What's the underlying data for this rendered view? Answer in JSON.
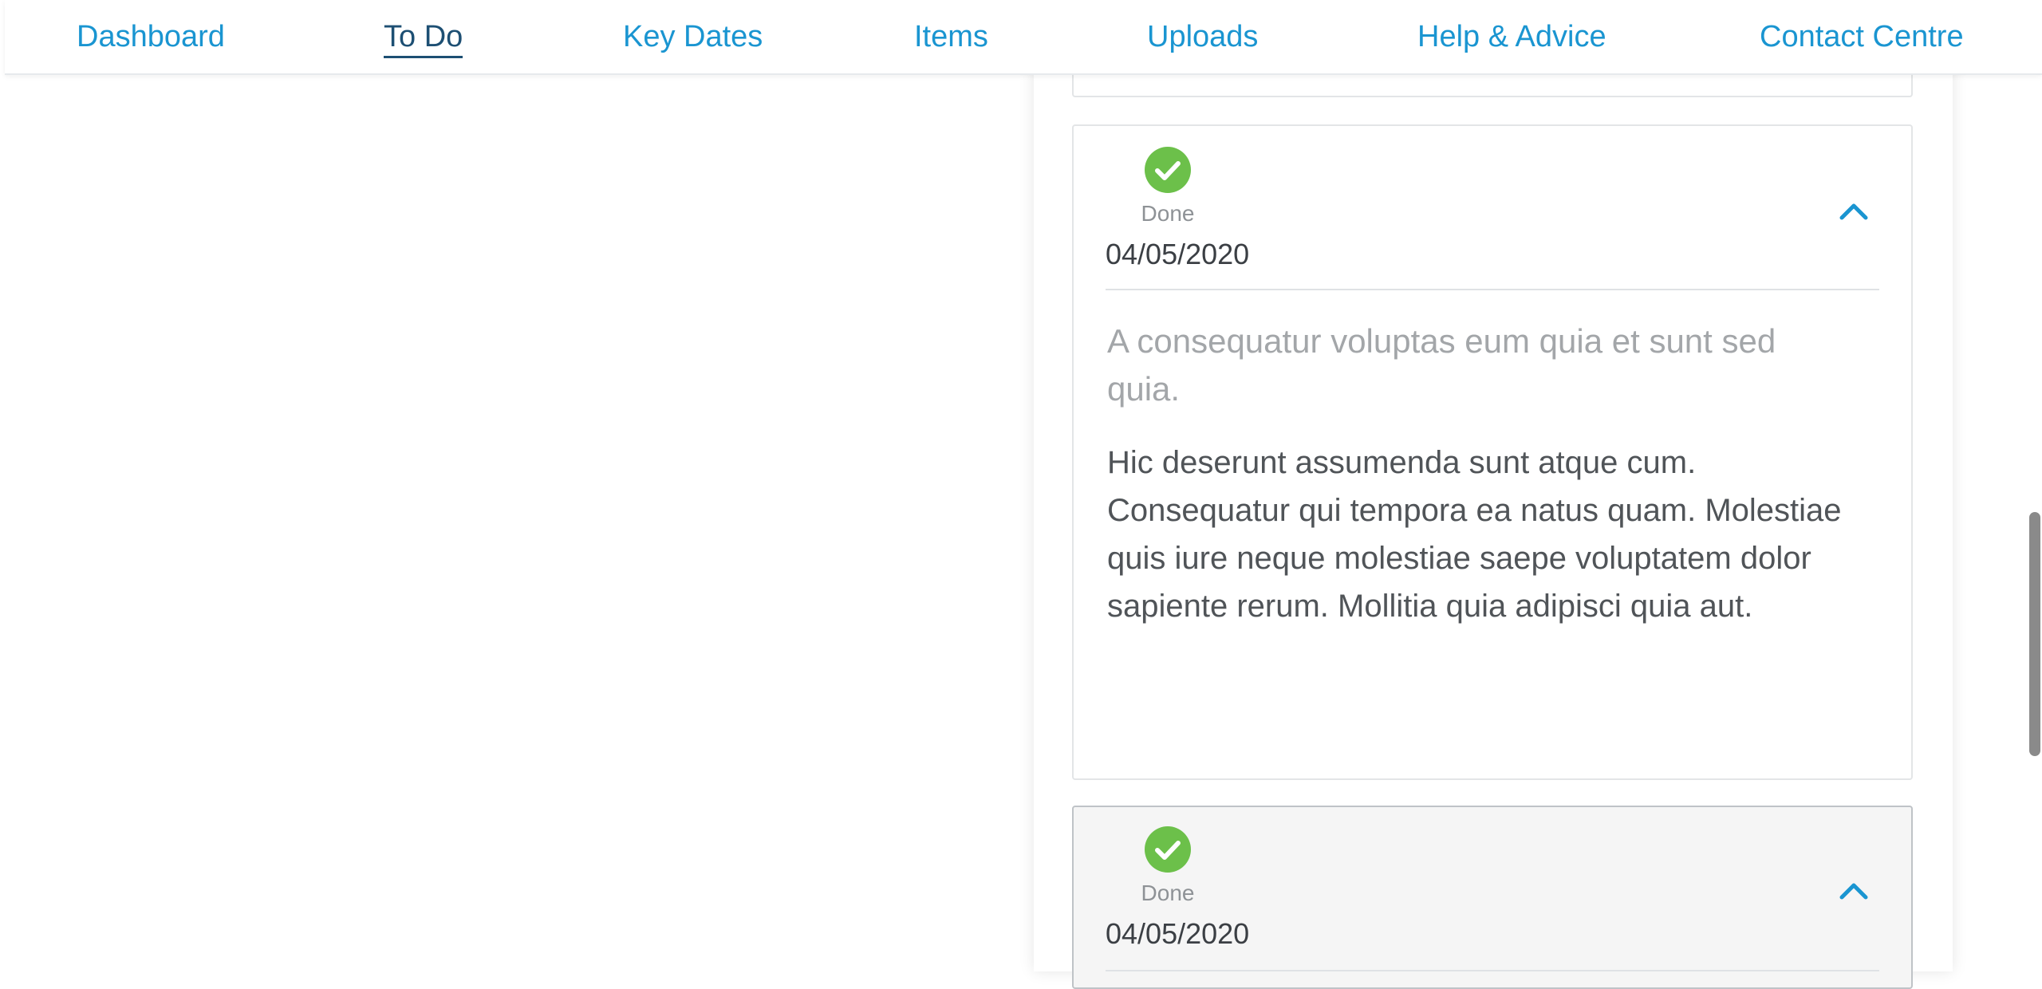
{
  "nav": {
    "items": [
      {
        "label": "Dashboard"
      },
      {
        "label": "To Do"
      },
      {
        "label": "Key Dates"
      },
      {
        "label": "Items"
      },
      {
        "label": "Uploads"
      },
      {
        "label": "Help & Advice"
      },
      {
        "label": "Contact Centre"
      }
    ],
    "active": "To Do"
  },
  "cards": [
    {
      "status": "Done",
      "date": "04/05/2020",
      "subtitle": "A consequatur voluptas eum quia et sunt sed quia.",
      "body": "Hic deserunt assumenda sunt atque cum. Consequatur qui tempora ea natus quam. Molestiae quis iure neque molestiae saepe voluptatem dolor sapiente rerum. Mollitia quia adipisci quia aut.",
      "expanded": true,
      "icon": "check-circle-icon"
    },
    {
      "status": "Done",
      "date": "04/05/2020",
      "expanded": true,
      "icon": "check-circle-icon"
    }
  ],
  "colors": {
    "link": "#1a95d1",
    "active_nav": "#1d4f73",
    "done_green": "#6cc04a",
    "chevron": "#1a95d1"
  }
}
